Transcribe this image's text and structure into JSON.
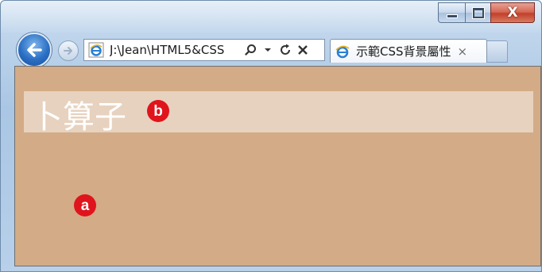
{
  "window": {
    "caption_buttons": {
      "minimize_icon": "minimize-icon",
      "maximize_icon": "maximize-icon",
      "close_glyph": "X"
    }
  },
  "navigation": {
    "back_icon": "back-arrow-icon",
    "forward_icon": "forward-arrow-icon"
  },
  "address_bar": {
    "url": "J:\\Jean\\HTML5&CSS",
    "site_icon": "ie-icon",
    "search_glyph": "⚲",
    "dropdown_glyph": "▾",
    "refresh_glyph": "↻",
    "stop_glyph": "✕"
  },
  "tab": {
    "title": "示範CSS背景屬性",
    "close_glyph": "×"
  },
  "page": {
    "background_color": "#d3ab86",
    "heading_bar_color": "#e7d2bf",
    "heading": "卜算子",
    "marker_a": "a",
    "marker_b": "b",
    "marker_color": "#e0141c"
  }
}
